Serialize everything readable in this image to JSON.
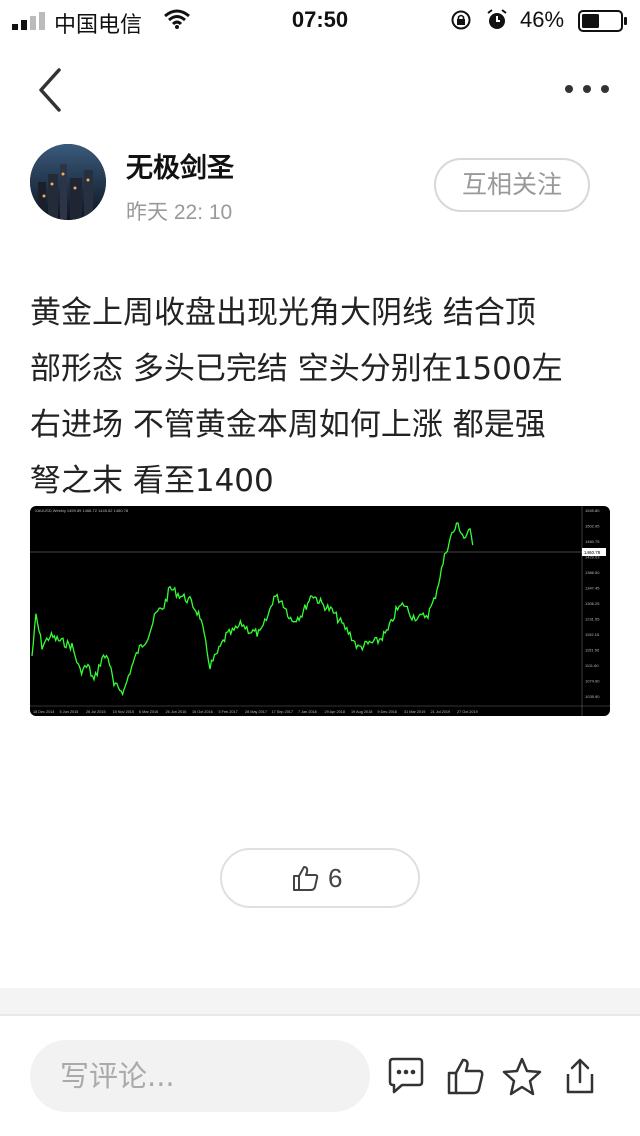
{
  "status_bar": {
    "carrier": "中国电信",
    "time": "07:50",
    "battery": "46%",
    "battery_level": 0.46
  },
  "nav": {
    "back_icon": "chevron-left-icon",
    "more_icon": "more-horizontal-icon"
  },
  "author": {
    "name": "无极剑圣",
    "time": "昨天 22: 10",
    "follow_label": "互相关注"
  },
  "post": {
    "line1": "黄金上周收盘出现光角大阴线 结合顶",
    "line2": "部形态 多头已完结 空头分别在1500左",
    "line3": "右进场 不管黄金本周如何上涨 都是强",
    "line4": "弩之末 看至1400"
  },
  "chart_image": {
    "header": "XAUUSD,Weekly 1459.89 1466.72 1445.62 1460.78",
    "y_ticks": [
      "1545.80",
      "1502.95",
      "1460.75",
      "1429.03",
      "1386.50",
      "1347.45",
      "1306.25",
      "1231.55",
      "1192.15",
      "1151.50",
      "1111.60",
      "1074.90",
      "1035.90"
    ],
    "x_ticks": [
      "18 Dec 2014",
      "5 Jun 2015",
      "26 Jul 2015",
      "15 Nov 2015",
      "6 Mar 2016",
      "26 Jun 2016",
      "16 Oct 2016",
      "5 Feb 2017",
      "28 May 2017",
      "17 Sep 2017",
      "7 Jan 2018",
      "29 Apr 2018",
      "19 Aug 2018",
      "9 Dec 2018",
      "31 Mar 2019",
      "21 Jul 2019",
      "27 Oct 2019"
    ],
    "current_price": "1460.78",
    "colors": {
      "background": "#000000",
      "line": "#33ff33",
      "grid": "#888888"
    }
  },
  "like": {
    "count": "6",
    "icon": "thumbs-up-icon"
  },
  "comment": {
    "placeholder": "写评论..."
  },
  "actions": [
    "comment-icon",
    "thumbs-up-icon",
    "star-icon",
    "share-icon"
  ]
}
